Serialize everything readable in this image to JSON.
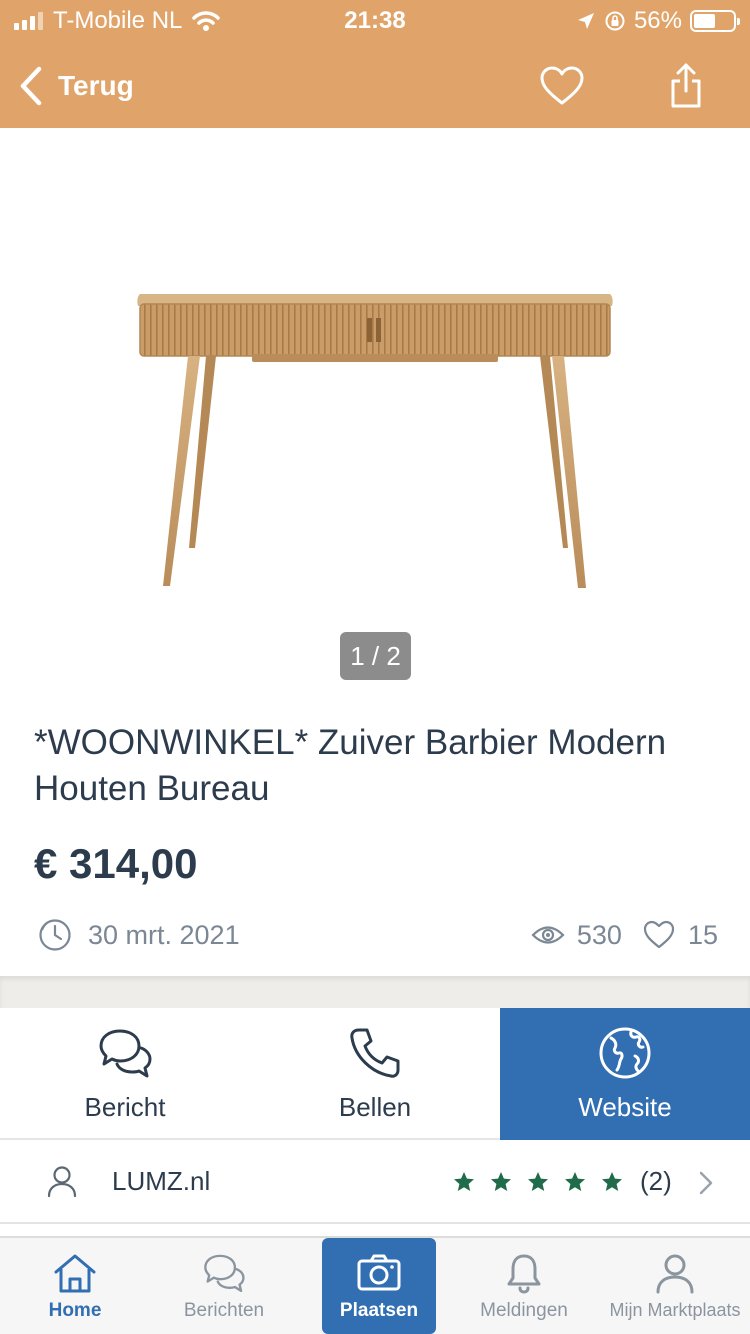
{
  "status_bar": {
    "carrier": "T-Mobile NL",
    "time": "21:38",
    "battery": "56%",
    "battery_level": 0.56
  },
  "nav": {
    "back_label": "Terug",
    "icons": [
      "chevron-left-icon",
      "heart-icon",
      "share-icon"
    ]
  },
  "gallery": {
    "counter": "1 / 2",
    "image_subject": "wooden-desk"
  },
  "listing": {
    "title": "*WOONWINKEL* Zuiver Barbier Modern Houten Bureau",
    "price": "€ 314,00",
    "date": "30 mrt. 2021",
    "views": "530",
    "favorites": "15"
  },
  "actions": {
    "message": "Bericht",
    "call": "Bellen",
    "website": "Website"
  },
  "seller": {
    "name": "LUMZ.nl",
    "stars": 5,
    "rating_count": "(2)"
  },
  "tabs": {
    "home": "Home",
    "messages": "Berichten",
    "place": "Plaatsen",
    "notifications": "Meldingen",
    "my": "Mijn Marktplaats"
  },
  "colors": {
    "header": "#e0a46a",
    "primary": "#326eb2",
    "star": "#1f6b4a",
    "text": "#2d3c4d"
  }
}
